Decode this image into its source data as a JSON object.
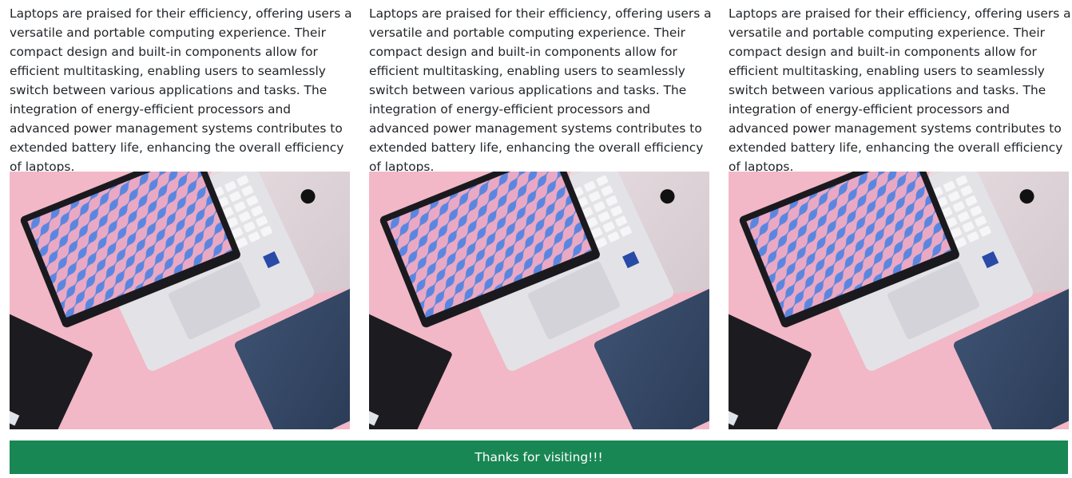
{
  "cards": [
    {
      "text": "Laptops are praised for their efficiency, offering users a versatile and portable computing experience. Their compact design and built-in components allow for efficient multitasking, enabling users to seamlessly switch between various applications and tasks. The integration of energy-efficient processors and advanced power management systems contributes to extended battery life, enhancing the overall efficiency of laptops.",
      "image": "laptops-on-pink-background"
    },
    {
      "text": "Laptops are praised for their efficiency, offering users a versatile and portable computing experience. Their compact design and built-in components allow for efficient multitasking, enabling users to seamlessly switch between various applications and tasks. The integration of energy-efficient processors and advanced power management systems contributes to extended battery life, enhancing the overall efficiency of laptops.",
      "image": "laptops-on-pink-background"
    },
    {
      "text": "Laptops are praised for their efficiency, offering users a versatile and portable computing experience. Their compact design and built-in components allow for efficient multitasking, enabling users to seamlessly switch between various applications and tasks. The integration of energy-efficient processors and advanced power management systems contributes to extended battery life, enhancing the overall efficiency of laptops.",
      "image": "laptops-on-pink-background"
    }
  ],
  "footer": {
    "text": "Thanks for visiting!!!"
  },
  "colors": {
    "footer_bg": "#198754",
    "pink_bg": "#f2b8c7",
    "text": "#212529"
  }
}
